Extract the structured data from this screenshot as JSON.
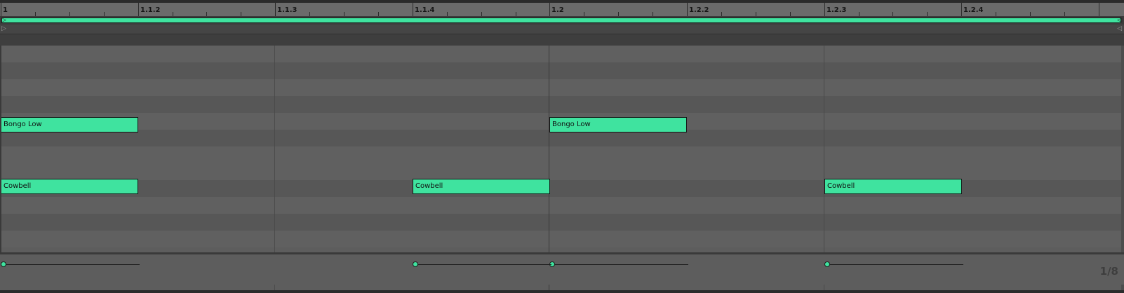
{
  "ruler": {
    "labels": [
      "1",
      "1.1.2",
      "1.1.3",
      "1.1.4",
      "1.2",
      "1.2.2",
      "1.2.3",
      "1.2.4"
    ]
  },
  "lanes": [
    {
      "shade": "a"
    },
    {
      "shade": "b"
    },
    {
      "shade": "a"
    },
    {
      "shade": "b"
    },
    {
      "shade": "a"
    },
    {
      "shade": "b"
    },
    {
      "shade": "a"
    },
    {
      "shade": "a"
    },
    {
      "shade": "b"
    },
    {
      "shade": "a"
    },
    {
      "shade": "b"
    },
    {
      "shade": "a"
    }
  ],
  "notes": [
    {
      "label": "Bongo Low",
      "beat": 0,
      "length": 1,
      "lane": 4
    },
    {
      "label": "Bongo Low",
      "beat": 4,
      "length": 1,
      "lane": 4
    },
    {
      "label": "Cowbell",
      "beat": 0,
      "length": 1,
      "lane": 8
    },
    {
      "label": "Cowbell",
      "beat": 3,
      "length": 1,
      "lane": 8
    },
    {
      "label": "Cowbell",
      "beat": 6,
      "length": 1,
      "lane": 8
    }
  ],
  "loop": {
    "left_marker": "▷",
    "right_marker": "◁"
  },
  "grid_size": "1/8",
  "colors": {
    "note": "#3fe39f",
    "loop": "#3fe39f"
  }
}
